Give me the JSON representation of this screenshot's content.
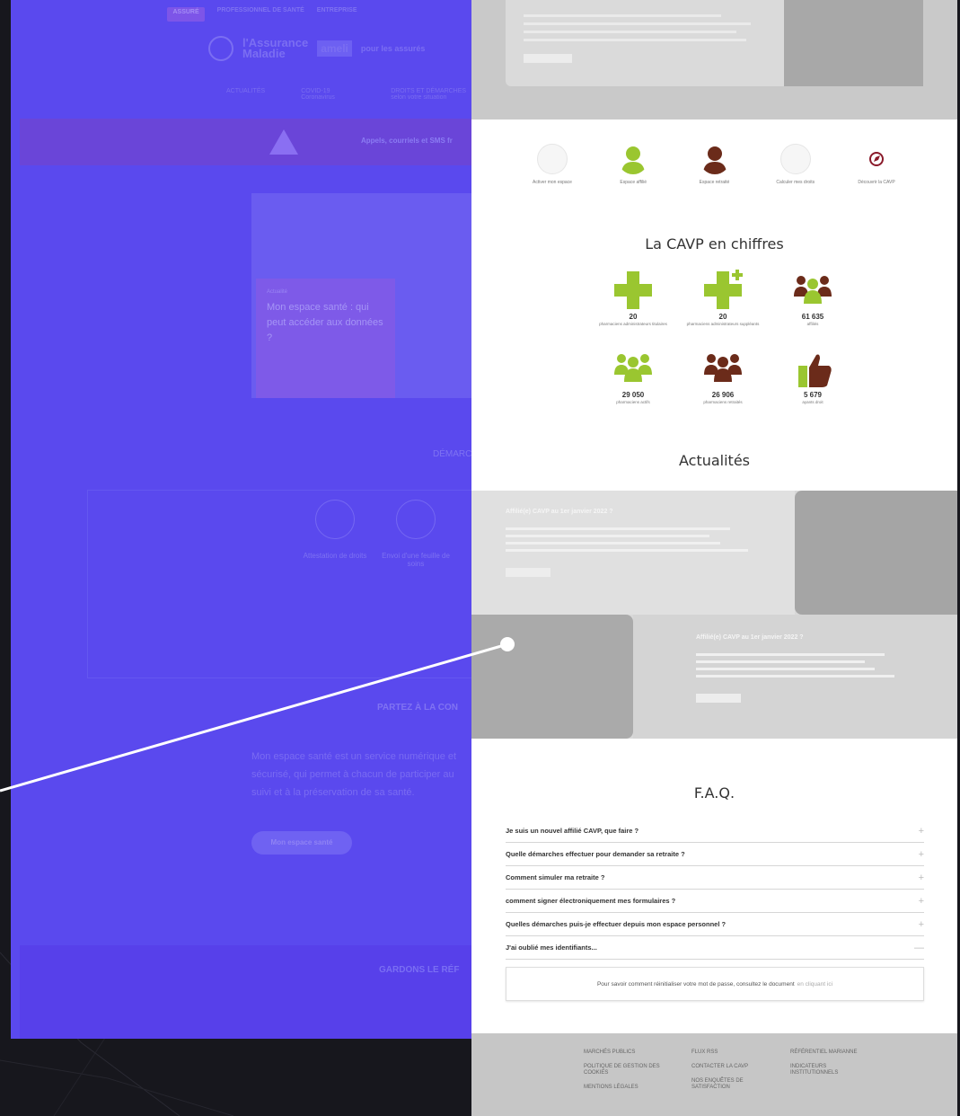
{
  "left_page": {
    "topbar": [
      "ASSURÉ",
      "PROFESSIONNEL DE SANTÉ",
      "ENTREPRISE"
    ],
    "brand_line1": "l'Assurance",
    "brand_line2": "Maladie",
    "ameli": "ameli",
    "for_users": "pour les assurés",
    "nav": [
      "ACTUALITÉS",
      "COVID-19 Coronavirus",
      "DROITS ET DÉMARCHES selon votre situation"
    ],
    "alert": "Appels, courriels et SMS fr",
    "hero_kicker": "Actualité",
    "hero_title": "Mon espace santé : qui peut accéder aux données ?",
    "demarches": "DÉMARC",
    "services": [
      "Attestation de droits",
      "Envoi d'une feuille de soins"
    ],
    "partez": "PARTEZ À LA CON",
    "mes_text": "Mon espace santé est un service numérique et sécurisé, qui permet à chacun de participer au suivi et à la préservation de sa santé.",
    "mes_btn": "Mon espace santé",
    "gardons": "GARDONS LE RÉF"
  },
  "right_page": {
    "quick_links": [
      {
        "label": "Activer mon espace",
        "icon": "activate-icon"
      },
      {
        "label": "Espace affilié",
        "icon": "user-green-icon"
      },
      {
        "label": "Espace retraité",
        "icon": "user-brown-icon"
      },
      {
        "label": "Calculer mes droits",
        "icon": "calculator-icon"
      },
      {
        "label": "Découvrir la CAVP",
        "icon": "compass-icon"
      }
    ],
    "stats_title": "La CAVP en chiffres",
    "stats": [
      {
        "num": "20",
        "label": "pharmaciens administrateurs titulaires",
        "icon": "cross-icon"
      },
      {
        "num": "20",
        "label": "pharmaciens administrateurs suppléants",
        "icon": "cross-plus-icon"
      },
      {
        "num": "61 635",
        "label": "affiliés",
        "icon": "people-icon"
      },
      {
        "num": "29 050",
        "label": "pharmaciens actifs",
        "icon": "people-green-icon"
      },
      {
        "num": "26 906",
        "label": "pharmaciens retraités",
        "icon": "people-brown-icon"
      },
      {
        "num": "5 679",
        "label": "ayants droit",
        "icon": "thumbs-up-icon"
      }
    ],
    "news_title": "Actualités",
    "news": [
      {
        "title": "Affilié(e) CAVP au 1er janvier 2022 ?",
        "btn": "Lire la suite"
      },
      {
        "title": "Affilié(e) CAVP au 1er janvier 2022 ?",
        "btn": "Lire la suite"
      }
    ],
    "faq_title": "F.A.Q.",
    "faq": [
      {
        "q": "Je suis un nouvel affilié CAVP, que faire ?",
        "sign": "+"
      },
      {
        "q": "Quelle démarches effectuer pour demander sa retraite ?",
        "sign": "+"
      },
      {
        "q": "Comment simuler ma retraite ?",
        "sign": "+"
      },
      {
        "q": "comment signer électroniquement mes formulaires ?",
        "sign": "+"
      },
      {
        "q": "Quelles démarches puis-je effectuer depuis mon espace personnel ?",
        "sign": "+"
      },
      {
        "q": "J'ai oublié mes identifiants...",
        "sign": "—"
      }
    ],
    "faq_answer": "Pour savoir comment réinitialiser votre mot de passe, consultez le document",
    "faq_answer_link": "en cliquant ici",
    "footer": {
      "col1": [
        "MARCHÉS PUBLICS",
        "POLITIQUE DE GESTION DES COOKIES",
        "MENTIONS LÉGALES"
      ],
      "col2": [
        "FLUX RSS",
        "CONTACTER LA CAVP",
        "NOS ENQUÊTES DE SATISFACTION"
      ],
      "col3": [
        "RÉFÉRENTIEL MARIANNE",
        "INDICATEURS INSTITUTIONNELS"
      ]
    }
  },
  "colors": {
    "overlay": "#5a49ee",
    "green": "#9ac630",
    "brown": "#6b2b1a"
  }
}
